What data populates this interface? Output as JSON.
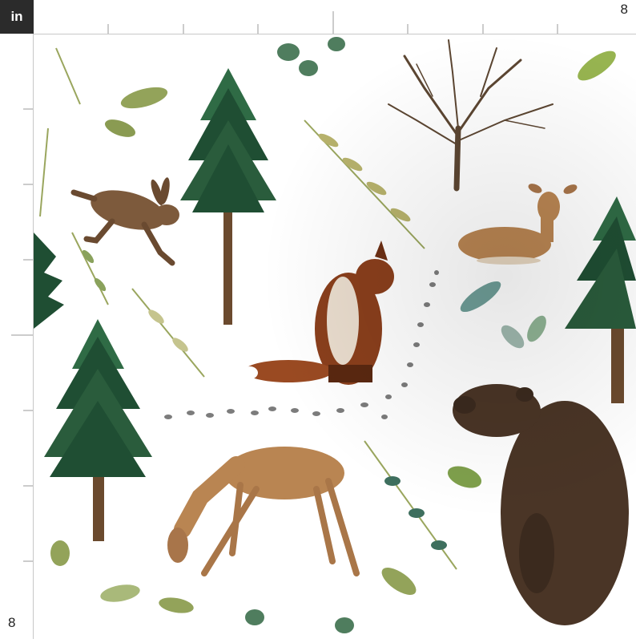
{
  "ruler": {
    "unit_label": "in",
    "top_end_label": "8",
    "left_end_label": "8"
  },
  "pattern": {
    "subject": [
      "pine-tree",
      "bare-tree",
      "hare",
      "fox",
      "fawn",
      "deer",
      "bear",
      "paw-prints",
      "leaf-sprigs"
    ],
    "colors": {
      "background": "#ffffff",
      "pine_green": "#1f4e33",
      "pine_light": "#2f6b45",
      "trunk_brown": "#6b4a2e",
      "fox_rust": "#8a3f1c",
      "deer_tan": "#b98552",
      "bear_brown": "#4a3526",
      "leaf_olive": "#93a35a",
      "leaf_sage": "#8fb394",
      "leaf_teal": "#3e6f5e",
      "track_gray": "#7c7c7c"
    }
  }
}
